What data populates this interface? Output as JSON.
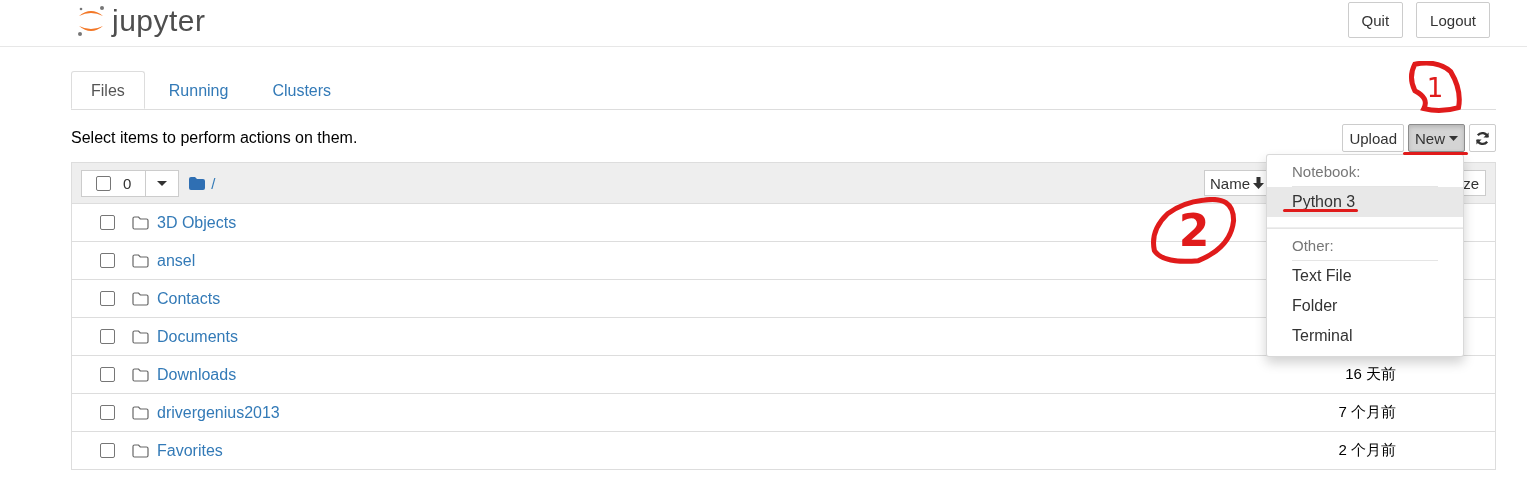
{
  "header": {
    "logo": "jupyter",
    "buttons": [
      "Quit",
      "Logout"
    ]
  },
  "tabs": [
    {
      "label": "Files",
      "selected": true
    },
    {
      "label": "Running",
      "selected": false
    },
    {
      "label": "Clusters",
      "selected": false
    }
  ],
  "toolbar": {
    "hint": "Select items to perform actions on them.",
    "buttons": [
      {
        "kind": "upload",
        "label": "Upload",
        "pressed": false
      },
      {
        "kind": "new",
        "label": "New",
        "pressed": true
      },
      {
        "kind": "refresh",
        "pressed": false
      }
    ]
  },
  "list_header": {
    "checked": false,
    "count": "0",
    "path": "/",
    "sort_buttons": [
      "Name",
      "ze"
    ]
  },
  "rows": [
    {
      "name": "3D Objects",
      "checked": false
    },
    {
      "name": "ansel",
      "checked": false
    },
    {
      "name": "Contacts",
      "checked": false
    },
    {
      "name": "Documents",
      "checked": false
    },
    {
      "name": "Downloads",
      "checked": false,
      "modified": "16 天前"
    },
    {
      "name": "drivergenius2013",
      "checked": false,
      "modified": "7 个月前"
    },
    {
      "name": "Favorites",
      "checked": false,
      "modified": "2 个月前"
    }
  ],
  "new_menu": {
    "sections": [
      {
        "heading": "Notebook:",
        "items": [
          {
            "label": "Python 3",
            "selected": true
          }
        ]
      },
      {
        "heading": "Other:",
        "items": [
          {
            "label": "Text File",
            "selected": false
          },
          {
            "label": "Folder",
            "selected": false
          },
          {
            "label": "Terminal",
            "selected": false
          }
        ]
      }
    ]
  },
  "annotations": [
    {
      "label": "1"
    },
    {
      "label": "2"
    }
  ]
}
